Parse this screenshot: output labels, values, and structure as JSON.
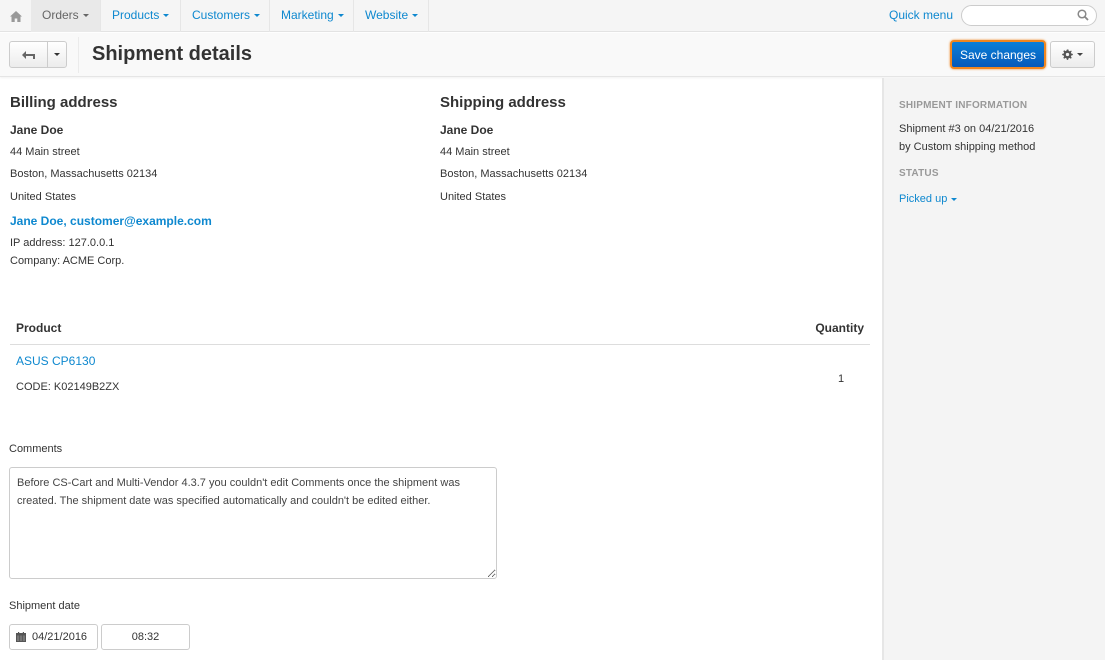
{
  "nav": {
    "home_icon": "home-icon",
    "items": [
      {
        "label": "Orders",
        "active": true
      },
      {
        "label": "Products",
        "active": false
      },
      {
        "label": "Customers",
        "active": false
      },
      {
        "label": "Marketing",
        "active": false
      },
      {
        "label": "Website",
        "active": false
      }
    ],
    "quick_menu": "Quick menu",
    "search_placeholder": "",
    "search_icon": "search-icon"
  },
  "toolbar": {
    "title": "Shipment details",
    "back_icon": "back-arrow-icon",
    "save_label": "Save changes",
    "gear_icon": "gear-icon",
    "colors": {
      "save_bg": "#0b6fcb",
      "save_outline": "#f0861f"
    }
  },
  "billing": {
    "title": "Billing address",
    "name": "Jane Doe",
    "street": "44 Main street",
    "city_line": "Boston, Massachusetts 02134",
    "country": "United States",
    "contact_link": "Jane Doe, customer@example.com",
    "ip": "IP address: 127.0.0.1",
    "company": "Company: ACME Corp."
  },
  "shipping": {
    "title": "Shipping address",
    "name": "Jane Doe",
    "street": "44 Main street",
    "city_line": "Boston, Massachusetts 02134",
    "country": "United States"
  },
  "products": {
    "columns": [
      "Product",
      "Quantity"
    ],
    "rows": [
      {
        "name": "ASUS CP6130",
        "code": "CODE: K02149B2ZX",
        "quantity": "1"
      }
    ]
  },
  "comments": {
    "label": "Comments",
    "value": "Before CS-Cart and Multi-Vendor 4.3.7 you couldn't edit Comments once the shipment was created. The shipment date was specified automatically and couldn't be edited either."
  },
  "shipment_date": {
    "label": "Shipment date",
    "date": "04/21/2016",
    "time": "08:32",
    "calendar_icon": "calendar-icon"
  },
  "sidebar": {
    "info_heading": "Shipment information",
    "info_line1": "Shipment #3 on 04/21/2016",
    "info_line2": "by Custom shipping method",
    "status_heading": "Status",
    "status_value": "Picked up"
  }
}
